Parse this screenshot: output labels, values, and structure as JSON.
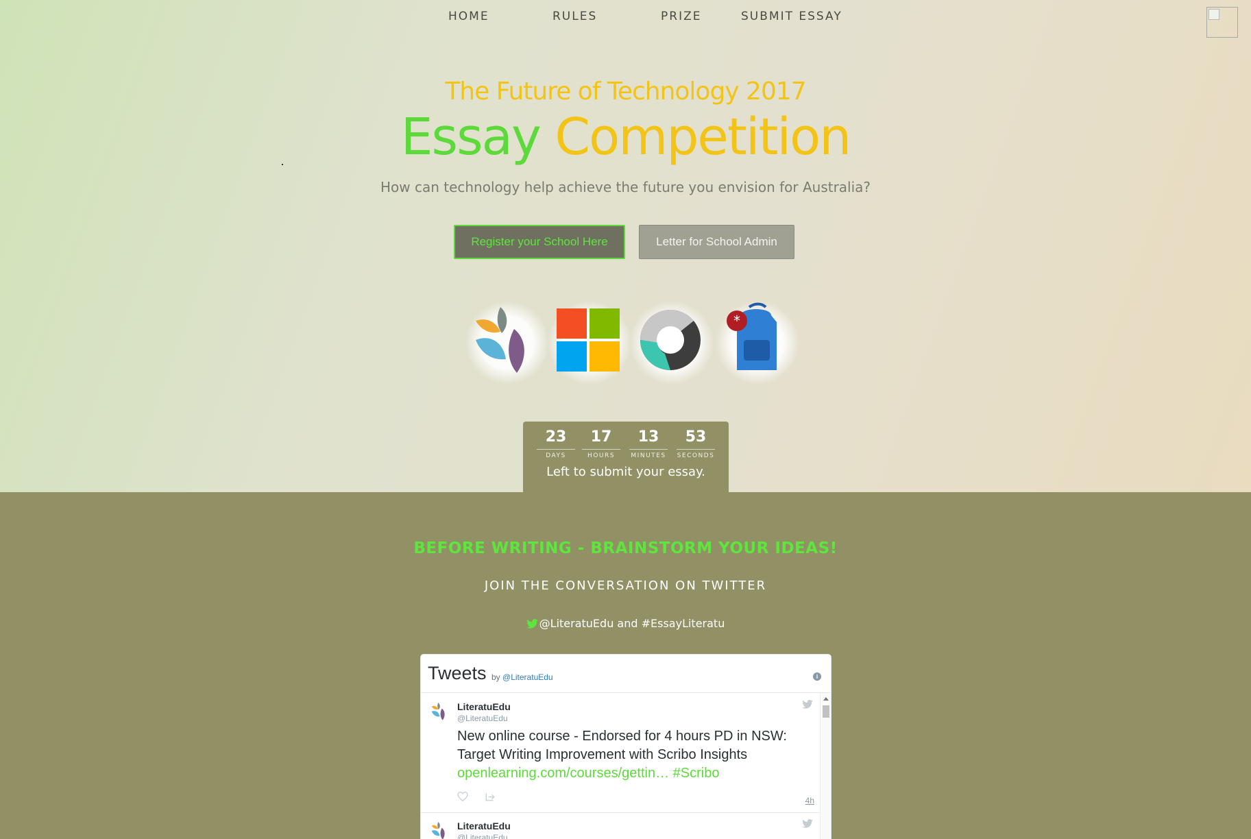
{
  "nav": {
    "items": [
      "HOME",
      "RULES",
      "PRIZE",
      "SUBMIT ESSAY"
    ]
  },
  "hero": {
    "subtitle": "The Future of Technology 2017",
    "title_word1": "Essay",
    "title_word2": "Competition",
    "question": "How can technology help achieve the future you envision for Australia?",
    "register_button": "Register your School Here",
    "letter_button": "Letter for School Admin",
    "sponsor_logos": [
      "literatu-leaf-logo",
      "microsoft-windows-logo",
      "ring-swirl-logo",
      "backpack-logo"
    ]
  },
  "countdown": {
    "units": [
      {
        "value": "23",
        "label": "DAYS"
      },
      {
        "value": "17",
        "label": "HOURS"
      },
      {
        "value": "13",
        "label": "MINUTES"
      },
      {
        "value": "53",
        "label": "SECONDS"
      }
    ],
    "caption": "Left to submit your essay."
  },
  "twitter_section": {
    "heading": "BEFORE WRITING - BRAINSTORM YOUR IDEAS!",
    "subheading": "JOIN THE CONVERSATION ON TWITTER",
    "handle_text": "@LiteratuEdu and #EssayLiteratu"
  },
  "tweets_widget": {
    "title": "Tweets",
    "by_prefix": "by",
    "by_handle": "@LiteratuEdu",
    "tweets": [
      {
        "name": "LiteratuEdu",
        "handle": "@LiteratuEdu",
        "text": "New online course - Endorsed for 4 hours PD in NSW: Target Writing Improvement with Scribo Insights",
        "link": "openlearning.com/courses/gettin…",
        "hashtag": "#Scribo",
        "time": "4h"
      },
      {
        "name": "LiteratuEdu",
        "handle": "@LiteratuEdu"
      }
    ]
  },
  "colors": {
    "accent_green": "#5ed93c",
    "accent_yellow": "#f2c418",
    "olive_band": "#929065"
  }
}
